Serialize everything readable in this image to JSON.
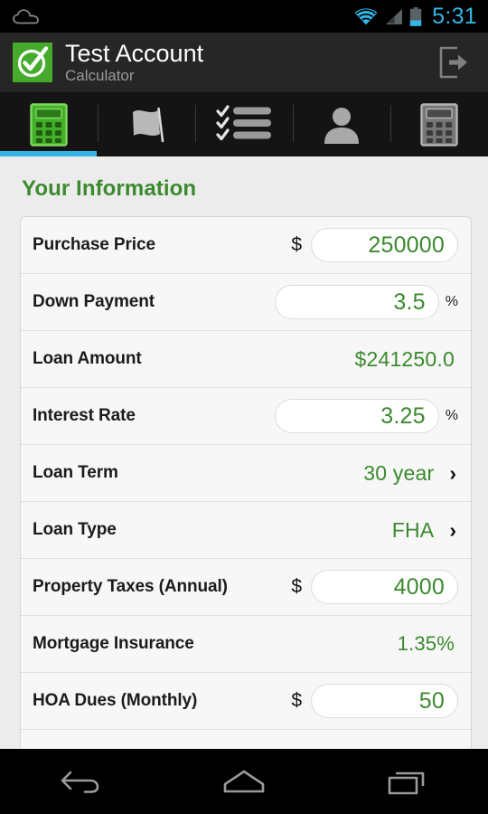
{
  "status_bar": {
    "notification_icon": "cloud-icon",
    "wifi_icon": "wifi-icon",
    "signal_icon": "signal-icon",
    "battery_icon": "battery-icon",
    "time": "5:31",
    "accent_color": "#33b5e5"
  },
  "action_bar": {
    "logo_icon": "check-circle-logo",
    "title": "Test Account",
    "subtitle": "Calculator",
    "logout_icon": "logout-icon",
    "background": "#262626"
  },
  "tabs": [
    {
      "icon": "calculator-icon",
      "name": "tab-calculator",
      "active": true
    },
    {
      "icon": "flag-icon",
      "name": "tab-flag",
      "active": false
    },
    {
      "icon": "checklist-icon",
      "name": "tab-checklist",
      "active": false
    },
    {
      "icon": "person-icon",
      "name": "tab-person",
      "active": false
    },
    {
      "icon": "calculator-gray-icon",
      "name": "tab-calculator-alt",
      "active": false
    }
  ],
  "main": {
    "section_title": "Your Information",
    "accent_green": "#3b8a2e",
    "rows": [
      {
        "label": "Purchase Price",
        "type": "money-input",
        "prefix": "$",
        "value": "250000"
      },
      {
        "label": "Down Payment",
        "type": "percent-input",
        "suffix": "%",
        "value": "3.5"
      },
      {
        "label": "Loan Amount",
        "type": "static",
        "value": "$241250.0"
      },
      {
        "label": "Interest Rate",
        "type": "percent-input",
        "suffix": "%",
        "value": "3.25"
      },
      {
        "label": "Loan Term",
        "type": "select",
        "value": "30 year",
        "chevron": "›"
      },
      {
        "label": "Loan Type",
        "type": "select",
        "value": "FHA",
        "chevron": "›"
      },
      {
        "label": "Property Taxes (Annual)",
        "type": "money-input",
        "prefix": "$",
        "value": "4000"
      },
      {
        "label": "Mortgage Insurance",
        "type": "static",
        "value": "1.35%"
      },
      {
        "label": "HOA Dues (Monthly)",
        "type": "money-input",
        "prefix": "$",
        "value": "50"
      }
    ]
  },
  "nav_bar": {
    "back_icon": "back-icon",
    "home_icon": "home-icon",
    "recents_icon": "recents-icon"
  }
}
